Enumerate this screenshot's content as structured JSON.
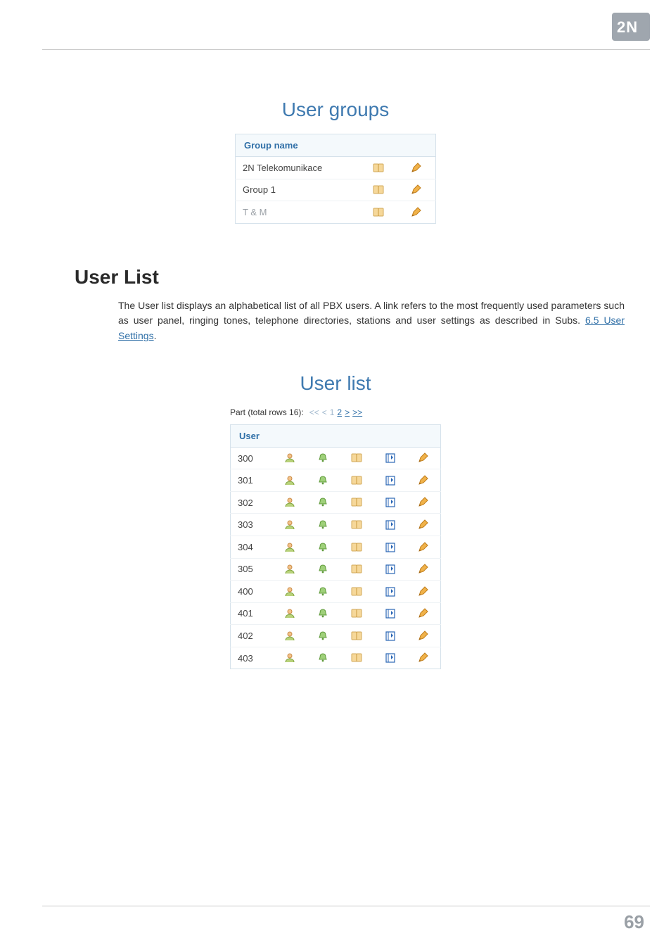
{
  "page_number": "69",
  "logo_text": "2N",
  "groups_panel": {
    "title": "User groups",
    "header": "Group name",
    "rows": [
      {
        "name": "2N Telekomunikace",
        "muted": false
      },
      {
        "name": "Group 1",
        "muted": false
      },
      {
        "name": "T & M",
        "muted": true
      }
    ]
  },
  "section": {
    "heading": "User List",
    "p_a": "The User list displays an alphabetical list of all PBX users. A link refers to the most frequently used parameters such as user panel, ringing tones, telephone directories, stations and user settings as described in Subs. ",
    "link_text": "6.5 User Settings",
    "p_b": "."
  },
  "userlist_panel": {
    "title": "User list",
    "pager": {
      "label": "Part (total rows 16):",
      "first": "<<",
      "prev": "<",
      "current": "1",
      "page2": "2",
      "next": ">",
      "last": ">>"
    },
    "header": "User",
    "rows": [
      "300",
      "301",
      "302",
      "303",
      "304",
      "305",
      "400",
      "401",
      "402",
      "403"
    ]
  },
  "icons": {
    "book": "book-icon",
    "pencil": "pencil-icon",
    "user": "user-icon",
    "bell": "bell-icon",
    "station": "station-icon"
  }
}
